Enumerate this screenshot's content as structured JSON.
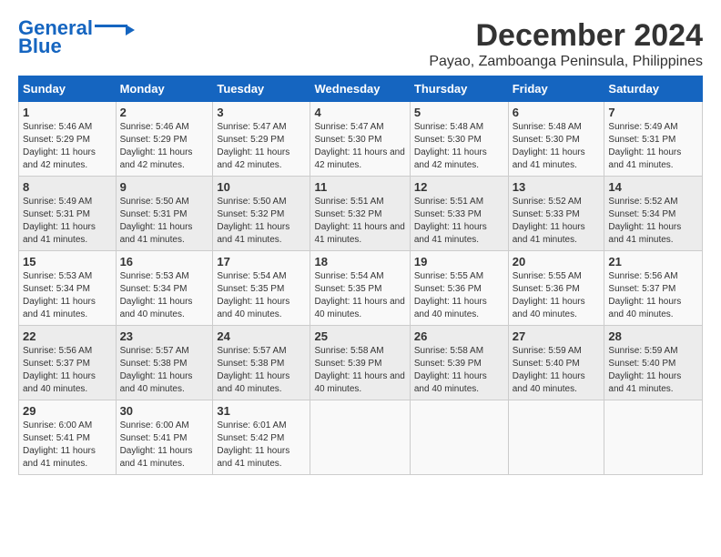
{
  "header": {
    "logo_line1": "General",
    "logo_line2": "Blue",
    "title": "December 2024",
    "subtitle": "Payao, Zamboanga Peninsula, Philippines"
  },
  "calendar": {
    "days_of_week": [
      "Sunday",
      "Monday",
      "Tuesday",
      "Wednesday",
      "Thursday",
      "Friday",
      "Saturday"
    ],
    "weeks": [
      [
        null,
        {
          "num": "2",
          "sunrise": "5:46 AM",
          "sunset": "5:29 PM",
          "daylight": "11 hours and 42 minutes."
        },
        {
          "num": "3",
          "sunrise": "5:47 AM",
          "sunset": "5:29 PM",
          "daylight": "11 hours and 42 minutes."
        },
        {
          "num": "4",
          "sunrise": "5:47 AM",
          "sunset": "5:30 PM",
          "daylight": "11 hours and 42 minutes."
        },
        {
          "num": "5",
          "sunrise": "5:48 AM",
          "sunset": "5:30 PM",
          "daylight": "11 hours and 42 minutes."
        },
        {
          "num": "6",
          "sunrise": "5:48 AM",
          "sunset": "5:30 PM",
          "daylight": "11 hours and 41 minutes."
        },
        {
          "num": "7",
          "sunrise": "5:49 AM",
          "sunset": "5:31 PM",
          "daylight": "11 hours and 41 minutes."
        }
      ],
      [
        {
          "num": "1",
          "sunrise": "5:46 AM",
          "sunset": "5:29 PM",
          "daylight": "11 hours and 42 minutes."
        },
        null,
        null,
        null,
        null,
        null,
        null
      ],
      [
        {
          "num": "8",
          "sunrise": "5:49 AM",
          "sunset": "5:31 PM",
          "daylight": "11 hours and 41 minutes."
        },
        {
          "num": "9",
          "sunrise": "5:50 AM",
          "sunset": "5:31 PM",
          "daylight": "11 hours and 41 minutes."
        },
        {
          "num": "10",
          "sunrise": "5:50 AM",
          "sunset": "5:32 PM",
          "daylight": "11 hours and 41 minutes."
        },
        {
          "num": "11",
          "sunrise": "5:51 AM",
          "sunset": "5:32 PM",
          "daylight": "11 hours and 41 minutes."
        },
        {
          "num": "12",
          "sunrise": "5:51 AM",
          "sunset": "5:33 PM",
          "daylight": "11 hours and 41 minutes."
        },
        {
          "num": "13",
          "sunrise": "5:52 AM",
          "sunset": "5:33 PM",
          "daylight": "11 hours and 41 minutes."
        },
        {
          "num": "14",
          "sunrise": "5:52 AM",
          "sunset": "5:34 PM",
          "daylight": "11 hours and 41 minutes."
        }
      ],
      [
        {
          "num": "15",
          "sunrise": "5:53 AM",
          "sunset": "5:34 PM",
          "daylight": "11 hours and 41 minutes."
        },
        {
          "num": "16",
          "sunrise": "5:53 AM",
          "sunset": "5:34 PM",
          "daylight": "11 hours and 40 minutes."
        },
        {
          "num": "17",
          "sunrise": "5:54 AM",
          "sunset": "5:35 PM",
          "daylight": "11 hours and 40 minutes."
        },
        {
          "num": "18",
          "sunrise": "5:54 AM",
          "sunset": "5:35 PM",
          "daylight": "11 hours and 40 minutes."
        },
        {
          "num": "19",
          "sunrise": "5:55 AM",
          "sunset": "5:36 PM",
          "daylight": "11 hours and 40 minutes."
        },
        {
          "num": "20",
          "sunrise": "5:55 AM",
          "sunset": "5:36 PM",
          "daylight": "11 hours and 40 minutes."
        },
        {
          "num": "21",
          "sunrise": "5:56 AM",
          "sunset": "5:37 PM",
          "daylight": "11 hours and 40 minutes."
        }
      ],
      [
        {
          "num": "22",
          "sunrise": "5:56 AM",
          "sunset": "5:37 PM",
          "daylight": "11 hours and 40 minutes."
        },
        {
          "num": "23",
          "sunrise": "5:57 AM",
          "sunset": "5:38 PM",
          "daylight": "11 hours and 40 minutes."
        },
        {
          "num": "24",
          "sunrise": "5:57 AM",
          "sunset": "5:38 PM",
          "daylight": "11 hours and 40 minutes."
        },
        {
          "num": "25",
          "sunrise": "5:58 AM",
          "sunset": "5:39 PM",
          "daylight": "11 hours and 40 minutes."
        },
        {
          "num": "26",
          "sunrise": "5:58 AM",
          "sunset": "5:39 PM",
          "daylight": "11 hours and 40 minutes."
        },
        {
          "num": "27",
          "sunrise": "5:59 AM",
          "sunset": "5:40 PM",
          "daylight": "11 hours and 40 minutes."
        },
        {
          "num": "28",
          "sunrise": "5:59 AM",
          "sunset": "5:40 PM",
          "daylight": "11 hours and 41 minutes."
        }
      ],
      [
        {
          "num": "29",
          "sunrise": "6:00 AM",
          "sunset": "5:41 PM",
          "daylight": "11 hours and 41 minutes."
        },
        {
          "num": "30",
          "sunrise": "6:00 AM",
          "sunset": "5:41 PM",
          "daylight": "11 hours and 41 minutes."
        },
        {
          "num": "31",
          "sunrise": "6:01 AM",
          "sunset": "5:42 PM",
          "daylight": "11 hours and 41 minutes."
        },
        null,
        null,
        null,
        null
      ]
    ]
  }
}
